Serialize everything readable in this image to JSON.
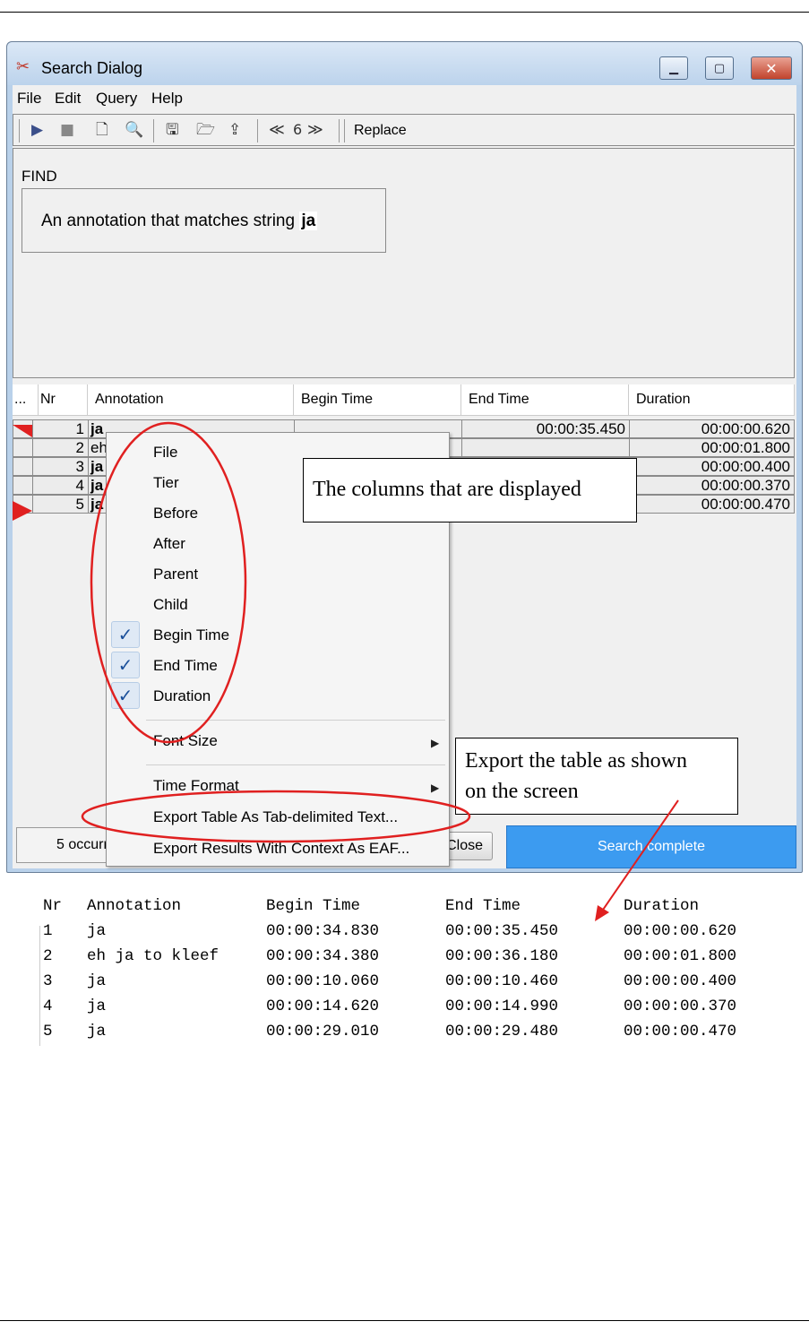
{
  "window": {
    "title": "Search Dialog",
    "app_icon": "elan-icon",
    "minimize_glyph": "▁",
    "maximize_glyph": "▢",
    "close_glyph": "✕"
  },
  "menubar": [
    "File",
    "Edit",
    "Query",
    "Help"
  ],
  "toolbar": {
    "page_number": "6",
    "replace_label": "Replace",
    "prev_glyph": "≪",
    "next_glyph": "≫"
  },
  "query": {
    "find_label": "FIND",
    "description": "An annotation that matches string",
    "search_string": "ja"
  },
  "table": {
    "columns": [
      "...",
      "Nr",
      "Annotation",
      "Begin Time",
      "End Time",
      "Duration"
    ],
    "rows": [
      {
        "nr": "1",
        "annotation": "ja",
        "begin": "",
        "end": "00:00:35.450",
        "duration": "00:00:00.620"
      },
      {
        "nr": "2",
        "annotation": "eh",
        "begin": "",
        "end": "",
        "duration": "00:00:01.800"
      },
      {
        "nr": "3",
        "annotation": "ja",
        "begin": "",
        "end": "",
        "duration": "00:00:00.400"
      },
      {
        "nr": "4",
        "annotation": "ja",
        "begin": "",
        "end": "",
        "duration": "00:00:00.370"
      },
      {
        "nr": "5",
        "annotation": "ja",
        "begin": "",
        "end": "",
        "duration": "00:00:00.470"
      }
    ]
  },
  "context_menu": {
    "items": [
      {
        "label": "File",
        "checked": false
      },
      {
        "label": "Tier",
        "checked": false
      },
      {
        "label": "Before",
        "checked": false
      },
      {
        "label": "After",
        "checked": false
      },
      {
        "label": "Parent",
        "checked": false
      },
      {
        "label": "Child",
        "checked": false
      },
      {
        "label": "Begin Time",
        "checked": true
      },
      {
        "label": "End Time",
        "checked": true
      },
      {
        "label": "Duration",
        "checked": true
      }
    ],
    "font_size": "Font Size",
    "time_format": "Time Format",
    "export_table": "Export Table As Tab-delimited Text...",
    "export_results": "Export Results With Context As EAF...",
    "check_glyph": "✓",
    "submenu_glyph": "▶"
  },
  "status": {
    "occurrences": "5 occurrences",
    "close_label": "Close",
    "progress_label": "Search complete"
  },
  "callouts": {
    "columns": "The columns that are displayed",
    "export_line1": "Export the table as shown",
    "export_line2": "on the screen"
  },
  "export_text": {
    "header": [
      "Nr",
      "Annotation",
      "Begin Time",
      "End Time",
      "Duration"
    ],
    "rows": [
      [
        "1",
        "ja",
        "00:00:34.830",
        "00:00:35.450",
        "00:00:00.620"
      ],
      [
        "2",
        "eh ja to kleef",
        "00:00:34.380",
        "00:00:36.180",
        "00:00:01.800"
      ],
      [
        "3",
        "ja",
        "00:00:10.060",
        "00:00:10.460",
        "00:00:00.400"
      ],
      [
        "4",
        "ja",
        "00:00:14.620",
        "00:00:14.990",
        "00:00:00.370"
      ],
      [
        "5",
        "ja",
        "00:00:29.010",
        "00:00:29.480",
        "00:00:00.470"
      ]
    ]
  },
  "colors": {
    "annotation_ring": "#e02020",
    "progress_fill": "#3c9bf0",
    "row_marker": "#e02020"
  }
}
